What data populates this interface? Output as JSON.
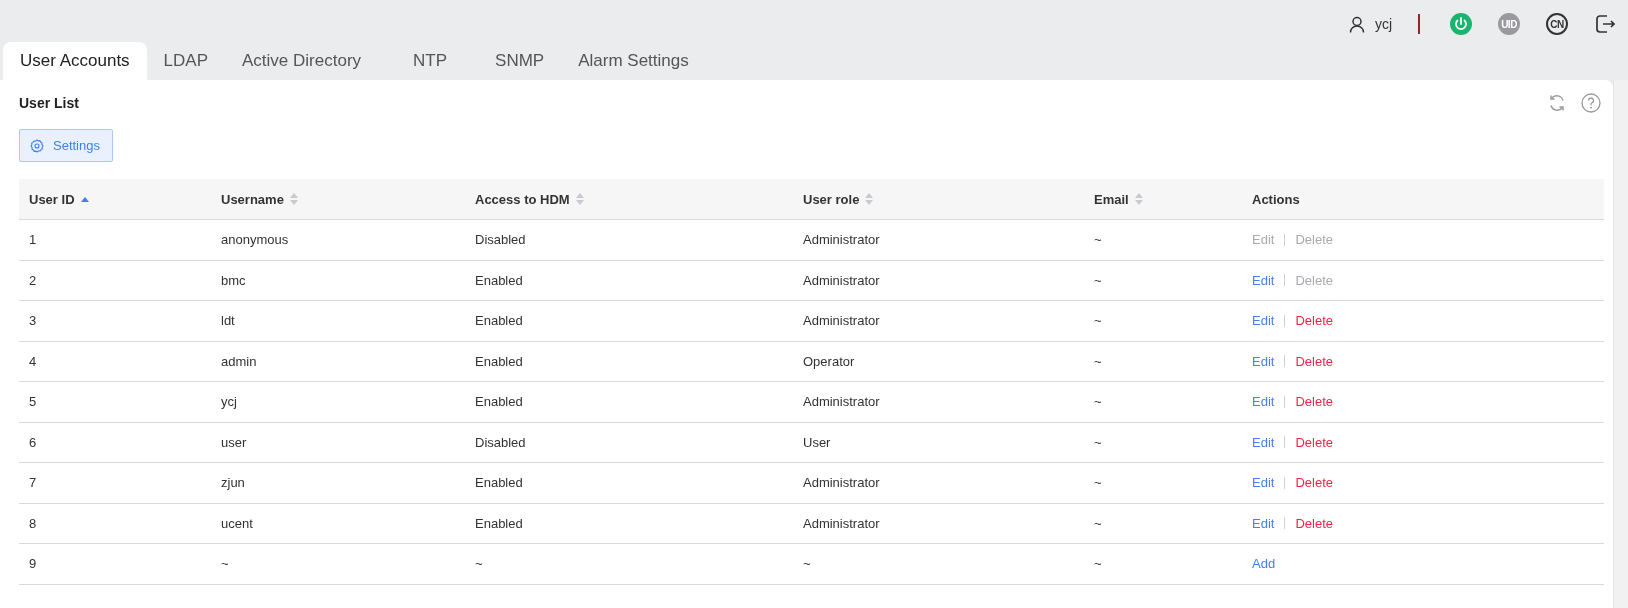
{
  "header": {
    "username": "ycj",
    "uid_label": "UID",
    "language": "CN"
  },
  "tabs": [
    {
      "label": "User Accounts",
      "selected": true
    },
    {
      "label": "LDAP",
      "selected": false
    },
    {
      "label": "Active Directory",
      "selected": false
    },
    {
      "label": "NTP",
      "selected": false
    },
    {
      "label": "SNMP",
      "selected": false
    },
    {
      "label": "Alarm Settings",
      "selected": false
    }
  ],
  "panel": {
    "title": "User List",
    "settings_button": "Settings"
  },
  "table": {
    "columns": [
      {
        "label": "User ID",
        "sorted": true
      },
      {
        "label": "Username",
        "sorted": false
      },
      {
        "label": "Access to HDM",
        "sorted": false
      },
      {
        "label": "User role",
        "sorted": false
      },
      {
        "label": "Email",
        "sorted": false
      },
      {
        "label": "Actions"
      }
    ],
    "rows": [
      {
        "cells": [
          "1",
          "anonymous",
          "Disabled",
          "Administrator",
          "~"
        ],
        "actions": [
          {
            "kind": "edit",
            "label": "Edit",
            "disabled": true
          },
          {
            "kind": "delete",
            "label": "Delete",
            "disabled": true
          }
        ]
      },
      {
        "cells": [
          "2",
          "bmc",
          "Enabled",
          "Administrator",
          "~"
        ],
        "actions": [
          {
            "kind": "edit",
            "label": "Edit",
            "disabled": false
          },
          {
            "kind": "delete",
            "label": "Delete",
            "disabled": true
          }
        ]
      },
      {
        "cells": [
          "3",
          "ldt",
          "Enabled",
          "Administrator",
          "~"
        ],
        "actions": [
          {
            "kind": "edit",
            "label": "Edit",
            "disabled": false
          },
          {
            "kind": "delete",
            "label": "Delete",
            "disabled": false
          }
        ]
      },
      {
        "cells": [
          "4",
          "admin",
          "Enabled",
          "Operator",
          "~"
        ],
        "actions": [
          {
            "kind": "edit",
            "label": "Edit",
            "disabled": false
          },
          {
            "kind": "delete",
            "label": "Delete",
            "disabled": false
          }
        ]
      },
      {
        "cells": [
          "5",
          "ycj",
          "Enabled",
          "Administrator",
          "~"
        ],
        "actions": [
          {
            "kind": "edit",
            "label": "Edit",
            "disabled": false
          },
          {
            "kind": "delete",
            "label": "Delete",
            "disabled": false
          }
        ]
      },
      {
        "cells": [
          "6",
          "user",
          "Disabled",
          "User",
          "~"
        ],
        "actions": [
          {
            "kind": "edit",
            "label": "Edit",
            "disabled": false
          },
          {
            "kind": "delete",
            "label": "Delete",
            "disabled": false
          }
        ]
      },
      {
        "cells": [
          "7",
          "zjun",
          "Enabled",
          "Administrator",
          "~"
        ],
        "actions": [
          {
            "kind": "edit",
            "label": "Edit",
            "disabled": false
          },
          {
            "kind": "delete",
            "label": "Delete",
            "disabled": false
          }
        ]
      },
      {
        "cells": [
          "8",
          "ucent",
          "Enabled",
          "Administrator",
          "~"
        ],
        "actions": [
          {
            "kind": "edit",
            "label": "Edit",
            "disabled": false
          },
          {
            "kind": "delete",
            "label": "Delete",
            "disabled": false
          }
        ]
      },
      {
        "cells": [
          "9",
          "~",
          "~",
          "~",
          "~"
        ],
        "actions": [
          {
            "kind": "add",
            "label": "Add",
            "disabled": false
          }
        ]
      }
    ]
  }
}
